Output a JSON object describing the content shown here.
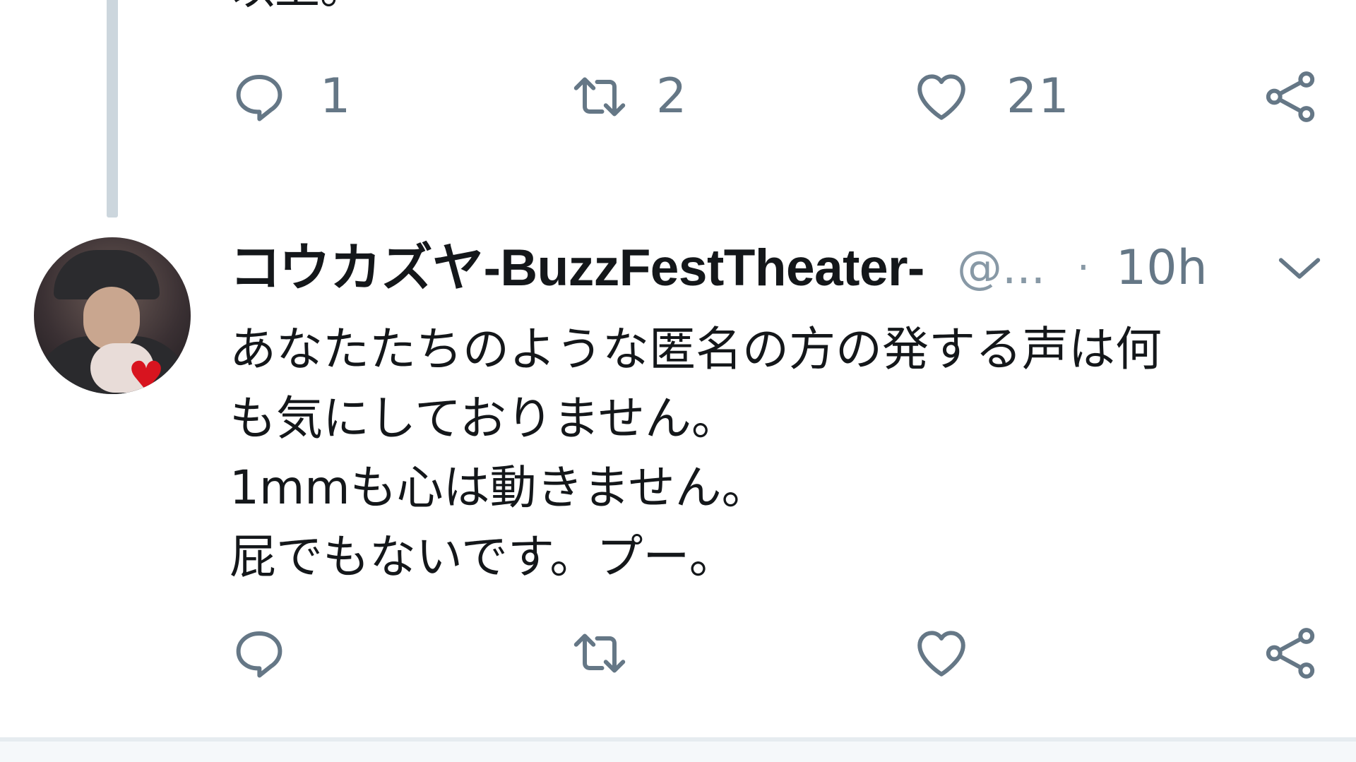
{
  "previous_tweet": {
    "text_fragment": "以上。",
    "actions": {
      "reply_count": "1",
      "retweet_count": "2",
      "like_count": "21"
    }
  },
  "tweet": {
    "display_name": "コウカズヤ-BuzzFestTheater-",
    "handle": "@...",
    "separator": "·",
    "time": "10h",
    "lines": [
      "あなたたちのような匿名の方の発する声は何",
      "も気にしておりません。",
      "1mmも心は動きません。",
      "屁でもないです。プー。"
    ],
    "actions": {
      "reply_count": "",
      "retweet_count": "",
      "like_count": ""
    }
  },
  "icons": {
    "reply": "reply-icon",
    "retweet": "retweet-icon",
    "like": "heart-icon",
    "share": "share-icon",
    "menu": "chevron-down-icon"
  },
  "colors": {
    "icon_gray": "#657786",
    "thread_line": "#ccd6dd",
    "heart_red": "#d8141f"
  }
}
